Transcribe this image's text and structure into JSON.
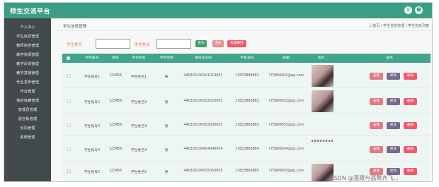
{
  "header": {
    "title": "师生交流平台"
  },
  "sidebar": {
    "items": [
      {
        "label": "个人中心"
      },
      {
        "label": "学生信息管理"
      },
      {
        "label": "教师信息管理"
      },
      {
        "label": "教学资源管理"
      },
      {
        "label": "教学反馈管理"
      },
      {
        "label": "教学答疑管理"
      },
      {
        "label": "作业发布管理"
      },
      {
        "label": "作业管理"
      },
      {
        "label": "我的收藏管理"
      },
      {
        "label": "管理员管理"
      },
      {
        "label": "留言板管理"
      },
      {
        "label": "论坛管理"
      },
      {
        "label": "系统管理"
      }
    ]
  },
  "page": {
    "title": "学生信息管理",
    "breadcrumb": "⌂ 首页 / 学生信息管理 / 学生信息列表"
  },
  "filters": {
    "student_no_label": "学生账号",
    "student_name_label": "学生姓名",
    "student_no_value": "",
    "student_name_value": "",
    "search_label": "查询",
    "add_label": "添加",
    "batch_delete_label": "批量删除"
  },
  "table": {
    "headers": [
      "学生账号",
      "密码",
      "学生姓名",
      "学生性别",
      "身份证号码",
      "手机号码",
      "邮箱",
      "照片",
      "操作"
    ],
    "rows": [
      {
        "account": "学生账号1",
        "password": "123456",
        "name": "学生姓名1",
        "gender": "男",
        "id_card": "440300199101010001",
        "phone": "13823888881",
        "email": "773890001@qq.com",
        "photo": "full"
      },
      {
        "account": "学生账号2",
        "password": "123456",
        "name": "学生姓名2",
        "gender": "男",
        "id_card": "440300199202020002",
        "phone": "13823888882",
        "email": "773890002@qq.com",
        "photo": "full"
      },
      {
        "account": "学生账号3",
        "password": "123456",
        "name": "学生姓名3",
        "gender": "男",
        "id_card": "440300199303030003",
        "phone": "13823888883",
        "email": "773890003@qq.com",
        "photo": "none"
      },
      {
        "account": "学生账号4",
        "password": "123456",
        "name": "学生姓名4",
        "gender": "男",
        "id_card": "440300199404040004",
        "phone": "13823888884",
        "email": "773890004@qq.com",
        "photo": "strip"
      },
      {
        "account": "学生账号5",
        "password": "123456",
        "name": "学生姓名5",
        "gender": "男",
        "id_card": "440300199505050005",
        "phone": "13823888885",
        "email": "773890005@qq.com",
        "photo": "full"
      }
    ],
    "actions": {
      "view": "查看",
      "edit": "修改",
      "delete": "删除"
    }
  },
  "watermark": "CSDN @落霞与孤鹜齐飞。。",
  "colors": {
    "primary": "#3a9e86",
    "sidebar": "#424a4c",
    "search_button": "#3f9e6e",
    "add_button": "#e98f8f",
    "delete_button": "#f05a6a",
    "view_button": "#e47a86",
    "edit_button": "#77688e",
    "filter_label": "#e07a4d"
  }
}
